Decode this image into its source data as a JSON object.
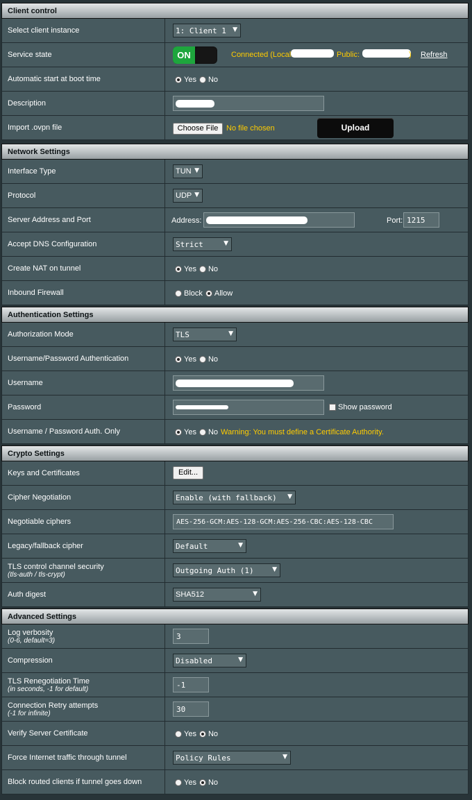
{
  "sections": {
    "client_control": "Client control",
    "network": "Network Settings",
    "auth": "Authentication Settings",
    "crypto": "Crypto Settings",
    "advanced": "Advanced Settings"
  },
  "labels": {
    "select_client": "Select client instance",
    "service_state": "Service state",
    "auto_start": "Automatic start at boot time",
    "description": "Description",
    "import_ovpn": "Import .ovpn file",
    "interface_type": "Interface Type",
    "protocol": "Protocol",
    "server_address": "Server Address and Port",
    "accept_dns": "Accept DNS Configuration",
    "create_nat": "Create NAT on tunnel",
    "inbound_fw": "Inbound Firewall",
    "auth_mode": "Authorization Mode",
    "userpass_auth": "Username/Password Authentication",
    "username": "Username",
    "password": "Password",
    "userpass_only": "Username / Password Auth. Only",
    "keys_certs": "Keys and Certificates",
    "cipher_neg": "Cipher Negotiation",
    "neg_ciphers": "Negotiable ciphers",
    "legacy_cipher": "Legacy/fallback cipher",
    "tls_control": "TLS control channel security",
    "tls_control_sub": "(tls-auth / tls-crypt)",
    "auth_digest": "Auth digest",
    "log_verb": "Log verbosity",
    "log_verb_sub": "(0-6, default=3)",
    "compression": "Compression",
    "tls_reneg": "TLS Renegotiation Time",
    "tls_reneg_sub": "(in seconds, -1 for default)",
    "conn_retry": "Connection Retry attempts",
    "conn_retry_sub": "(-1 for infinite)",
    "verify_cert": "Verify Server Certificate",
    "force_traffic": "Force Internet traffic through tunnel",
    "block_routed": "Block routed clients if tunnel goes down"
  },
  "values": {
    "client_instance": "1: Client 1",
    "toggle_on": "ON",
    "status_connected": "Connected (Local:",
    "status_public": "Public:",
    "status_close": ")",
    "refresh": "Refresh",
    "yes": "Yes",
    "no": "No",
    "block": "Block",
    "allow": "Allow",
    "choose_file": "Choose File",
    "no_file": "No file chosen",
    "upload": "Upload",
    "interface_type": "TUN",
    "protocol": "UDP",
    "address_label": "Address:",
    "port_label": "Port:",
    "port": "1215",
    "accept_dns": "Strict",
    "auth_mode": "TLS",
    "show_password": "Show password",
    "warning": "Warning: You must define a Certificate Authority.",
    "edit": "Edit...",
    "cipher_neg": "Enable (with fallback)",
    "neg_ciphers": "AES-256-GCM:AES-128-GCM:AES-256-CBC:AES-128-CBC",
    "legacy_cipher": "Default",
    "tls_control": "Outgoing Auth (1)",
    "auth_digest": "SHA512",
    "log_verb": "3",
    "compression": "Disabled",
    "tls_reneg": "-1",
    "conn_retry": "30",
    "force_traffic": "Policy Rules"
  },
  "colors": {
    "panel": "#475a5f",
    "background": "#283438",
    "accent_yellow": "#ffcc00",
    "toggle_green": "#1ea63d"
  }
}
